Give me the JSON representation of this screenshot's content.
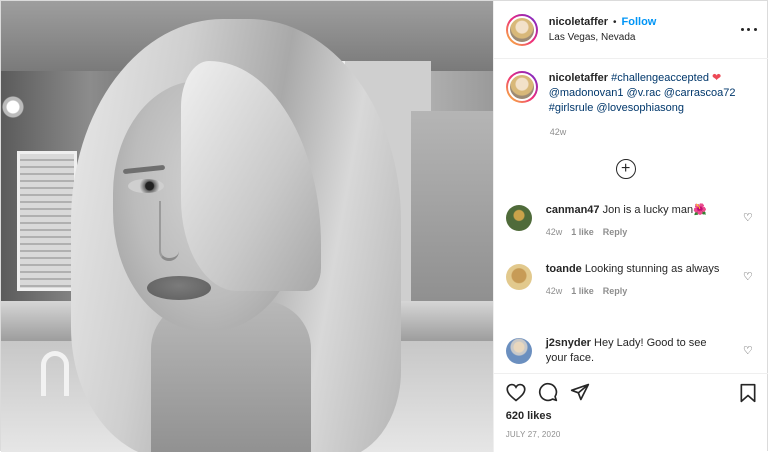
{
  "post": {
    "username": "nicoletaffer",
    "separator": "•",
    "follow_label": "Follow",
    "location": "Las Vegas, Nevada",
    "more_icon": "more-options-icon"
  },
  "caption": {
    "username": "nicoletaffer",
    "hashtag": "#challengeaccepted",
    "emoji": "❤",
    "mentions_line": "@madonovan1 @v.rac @carrascoa72",
    "last_line_tag": "#girlsrule",
    "last_line_mention": "@lovesophiasong",
    "time": "42w"
  },
  "load_more_icon": "plus-circle-icon",
  "comments": [
    {
      "username": "canman47",
      "text": "Jon is a lucky man",
      "emoji": "🌺",
      "time": "42w",
      "likes": "1 like",
      "reply": "Reply"
    },
    {
      "username": "toande",
      "text": "Looking stunning as always",
      "time": "42w",
      "likes": "1 like",
      "reply": "Reply"
    },
    {
      "username": "j2snyder",
      "text": "Hey Lady! Good to see your face."
    }
  ],
  "actions": {
    "like_icon": "heart-icon",
    "comment_icon": "comment-icon",
    "share_icon": "share-icon",
    "save_icon": "bookmark-icon",
    "likes": "620 likes",
    "date": "JULY 27, 2020"
  },
  "colors": {
    "link": "#0095f6",
    "tag": "#00376b",
    "muted": "#8e8e8e",
    "text": "#262626"
  }
}
